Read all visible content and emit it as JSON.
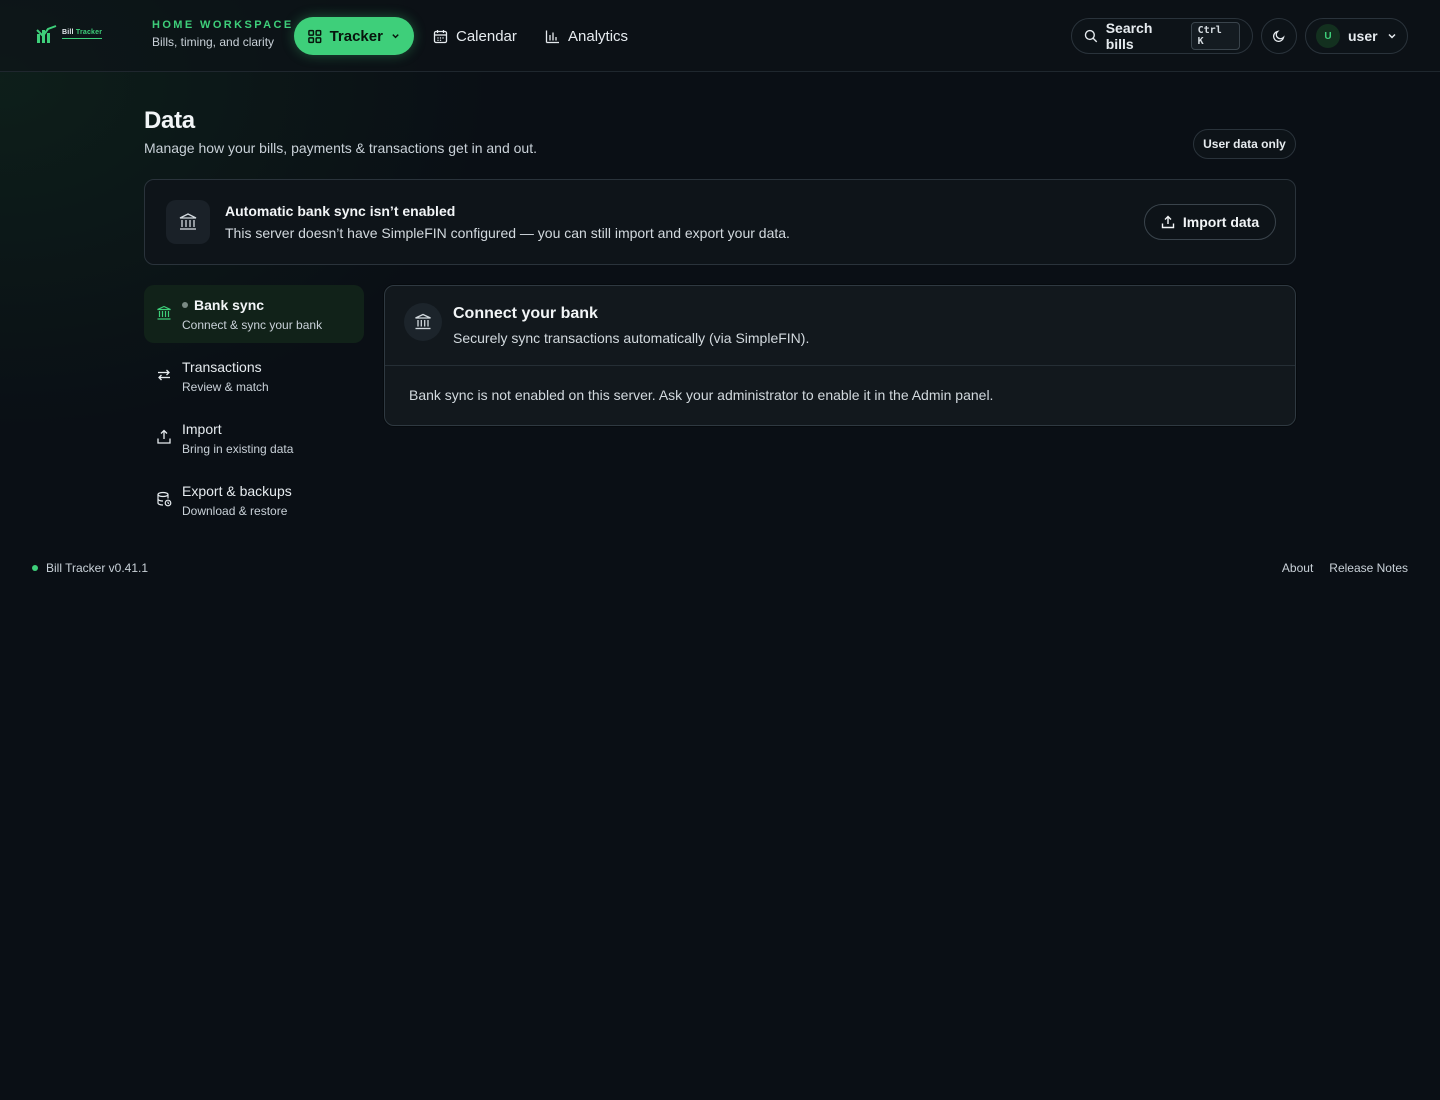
{
  "header": {
    "logo_text_a": "Bill",
    "logo_text_b": "Tracker",
    "workspace_eyebrow": "HOME WORKSPACE",
    "workspace_sub": "Bills, timing, and clarity",
    "nav": {
      "tracker": "Tracker",
      "calendar": "Calendar",
      "analytics": "Analytics"
    },
    "search_label": "Search bills",
    "search_shortcut": "Ctrl K",
    "user_initial": "U",
    "user_name": "user"
  },
  "page": {
    "title": "Data",
    "subtitle": "Manage how your bills, payments & transactions get in and out.",
    "scope_badge": "User data only"
  },
  "alert": {
    "title": "Automatic bank sync isn’t enabled",
    "text": "This server doesn’t have SimpleFIN configured — you can still import and export your data.",
    "import_label": "Import data"
  },
  "sidebar": {
    "items": [
      {
        "label": "Bank sync",
        "sub": "Connect & sync your bank",
        "icon": "bank-icon",
        "active": true
      },
      {
        "label": "Transactions",
        "sub": "Review & match",
        "icon": "swap-arrows-icon",
        "active": false
      },
      {
        "label": "Import",
        "sub": "Bring in existing data",
        "icon": "upload-icon",
        "active": false
      },
      {
        "label": "Export & backups",
        "sub": "Download & restore",
        "icon": "database-export-icon",
        "active": false
      }
    ]
  },
  "card": {
    "title": "Connect your bank",
    "subtitle": "Securely sync transactions automatically (via SimpleFIN).",
    "body": "Bank sync is not enabled on this server. Ask your administrator to enable it in the Admin panel."
  },
  "footer": {
    "version": "Bill Tracker v0.41.1",
    "links": [
      "About",
      "Release Notes"
    ]
  },
  "colors": {
    "accent": "#3ecf7a",
    "background": "#0a0f15",
    "card": "#12181d"
  }
}
